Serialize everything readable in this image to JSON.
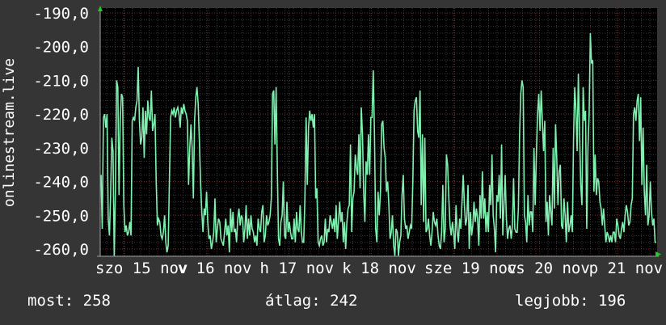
{
  "chart_data": {
    "type": "line",
    "ylabel": "onlinestream.live",
    "xlabel": "",
    "title": "",
    "ylim": [
      -262,
      -190
    ],
    "y_ticks": [
      "-190,0",
      "-200,0",
      "-210,0",
      "-220,0",
      "-230,0",
      "-240,0",
      "-250,0",
      "-260,0"
    ],
    "y_tick_values": [
      -190,
      -200,
      -210,
      -220,
      -230,
      -240,
      -250,
      -260
    ],
    "x_ticks": [
      "szo 15 nov",
      "v 16 nov",
      "h 17 nov",
      "k 18 nov",
      "sze 19 nov",
      "cs 20 nov",
      "p 21 nov"
    ],
    "xlim": [
      0,
      1
    ],
    "x_tick_positions": [
      0.0,
      0.1477,
      0.2954,
      0.4431,
      0.5908,
      0.7385,
      0.8862
    ],
    "grid": true,
    "line_color": "#80f0b0",
    "grid_color": "#6a6a6a",
    "series": [
      {
        "values": [
          -238,
          -254,
          -221,
          -220,
          -224,
          -220,
          -251,
          -256,
          -244,
          -227,
          -231,
          -262,
          -243,
          -210,
          -212,
          -244,
          -222,
          -214,
          -215,
          -247,
          -255,
          -253,
          -256,
          -255,
          -252,
          -256,
          -222,
          -221,
          -222,
          -218,
          -216,
          -206,
          -222,
          -229,
          -227,
          -218,
          -233,
          -219,
          -226,
          -216,
          -221,
          -222,
          -213,
          -225,
          -223,
          -220,
          -240,
          -253,
          -251,
          -252,
          -256,
          -257,
          -255,
          -250,
          -258,
          -261,
          -259,
          -240,
          -221,
          -219,
          -220,
          -218,
          -221,
          -219,
          -218,
          -220,
          -224,
          -218,
          -220,
          -217,
          -219,
          -220,
          -222,
          -241,
          -230,
          -223,
          -230,
          -245,
          -222,
          -215,
          -212,
          -217,
          -228,
          -240,
          -249,
          -255,
          -248,
          -250,
          -243,
          -252,
          -257,
          -256,
          -260,
          -258,
          -255,
          -245,
          -258,
          -254,
          -251,
          -252,
          -257,
          -258,
          -259,
          -255,
          -251,
          -256,
          -253,
          -261,
          -248,
          -255,
          -249,
          -255,
          -254,
          -258,
          -251,
          -248,
          -253,
          -250,
          -251,
          -258,
          -254,
          -247,
          -257,
          -251,
          -256,
          -250,
          -254,
          -255,
          -258,
          -256,
          -259,
          -251,
          -254,
          -255,
          -249,
          -247,
          -258,
          -256,
          -250,
          -253,
          -252,
          -250,
          -245,
          -214,
          -213,
          -229,
          -212,
          -236,
          -257,
          -259,
          -252,
          -250,
          -240,
          -256,
          -257,
          -246,
          -255,
          -252,
          -255,
          -257,
          -257,
          -251,
          -258,
          -249,
          -254,
          -255,
          -247,
          -255,
          -258,
          -258,
          -245,
          -221,
          -241,
          -224,
          -219,
          -222,
          -220,
          -224,
          -220,
          -245,
          -242,
          -258,
          -259,
          -257,
          -256,
          -259,
          -258,
          -251,
          -258,
          -254,
          -255,
          -250,
          -252,
          -254,
          -251,
          -255,
          -247,
          -257,
          -252,
          -246,
          -252,
          -249,
          -258,
          -252,
          -260,
          -252,
          -248,
          -247,
          -229,
          -255,
          -245,
          -243,
          -232,
          -236,
          -238,
          -226,
          -242,
          -218,
          -226,
          -243,
          -252,
          -234,
          -238,
          -226,
          -238,
          -221,
          -221,
          -207,
          -226,
          -254,
          -258,
          -243,
          -250,
          -243,
          -223,
          -222,
          -230,
          -233,
          -243,
          -240,
          -247,
          -257,
          -255,
          -250,
          -259,
          -262,
          -254,
          -255,
          -262,
          -258,
          -256,
          -244,
          -238,
          -251,
          -254,
          -253,
          -257,
          -255,
          -253,
          -254,
          -240,
          -219,
          -216,
          -215,
          -225,
          -227,
          -213,
          -247,
          -226,
          -252,
          -227,
          -255,
          -254,
          -251,
          -256,
          -259,
          -255,
          -249,
          -252,
          -253,
          -251,
          -256,
          -259,
          -260,
          -255,
          -241,
          -258,
          -254,
          -232,
          -235,
          -245,
          -253,
          -256,
          -252,
          -255,
          -260,
          -247,
          -255,
          -258,
          -251,
          -254,
          -246,
          -238,
          -247,
          -253,
          -251,
          -241,
          -260,
          -249,
          -256,
          -253,
          -246,
          -252,
          -248,
          -251,
          -259,
          -244,
          -251,
          -237,
          -251,
          -245,
          -255,
          -249,
          -255,
          -241,
          -247,
          -232,
          -250,
          -254,
          -261,
          -244,
          -246,
          -238,
          -251,
          -229,
          -256,
          -247,
          -238,
          -251,
          -257,
          -254,
          -253,
          -257,
          -253,
          -239,
          -254,
          -255,
          -255,
          -248,
          -226,
          -214,
          -210,
          -212,
          -250,
          -252,
          -258,
          -244,
          -253,
          -249,
          -249,
          -255,
          -230,
          -247,
          -232,
          -220,
          -214,
          -225,
          -213,
          -222,
          -231,
          -222,
          -252,
          -246,
          -256,
          -244,
          -249,
          -253,
          -230,
          -248,
          -223,
          -233,
          -247,
          -237,
          -235,
          -253,
          -254,
          -245,
          -250,
          -258,
          -246,
          -255,
          -253,
          -250,
          -255,
          -227,
          -212,
          -219,
          -231,
          -208,
          -225,
          -241,
          -247,
          -212,
          -222,
          -219,
          -254,
          -230,
          -220,
          -196,
          -205,
          -204,
          -243,
          -232,
          -244,
          -239,
          -240,
          -246,
          -248,
          -253,
          -248,
          -253,
          -258,
          -255,
          -256,
          -258,
          -256,
          -258,
          -255,
          -255,
          -258,
          -251,
          -253,
          -256,
          -257,
          -254,
          -252,
          -255,
          -250,
          -247,
          -249,
          -253,
          -252,
          -247,
          -245,
          -220,
          -218,
          -222,
          -216,
          -214,
          -228,
          -215,
          -241,
          -224,
          -243,
          -250,
          -235,
          -253,
          -250,
          -240,
          -249,
          -253,
          -251,
          -258,
          -258
        ]
      }
    ]
  },
  "footer": {
    "now": "most: 258",
    "avg": "átlag: 242",
    "best": "legjobb: 196"
  }
}
